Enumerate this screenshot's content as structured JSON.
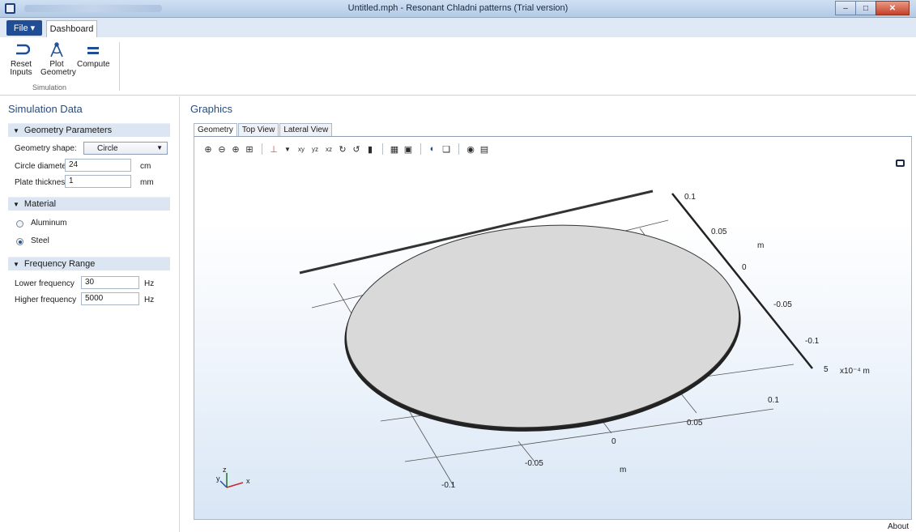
{
  "window": {
    "title": "Untitled.mph - Resonant Chladni patterns (Trial version)"
  },
  "ribbon": {
    "file_label": "File ▾",
    "tab_dashboard": "Dashboard",
    "reset_line1": "Reset",
    "reset_line2": "Inputs",
    "plot_line1": "Plot",
    "plot_line2": "Geometry",
    "compute_label": "Compute",
    "group_label": "Simulation"
  },
  "left": {
    "title": "Simulation Data",
    "geometry_section": "Geometry Parameters",
    "geometry_shape_label": "Geometry shape:",
    "geometry_shape_value": "Circle",
    "circle_diameter_label": "Circle diameter:",
    "circle_diameter_value": "24",
    "circle_diameter_unit": "cm",
    "plate_thickness_label": "Plate thickness:",
    "plate_thickness_value": "1",
    "plate_thickness_unit": "mm",
    "material_section": "Material",
    "material_options": [
      "Aluminum",
      "Steel"
    ],
    "material_selected": "Steel",
    "frequency_section": "Frequency Range",
    "lower_label": "Lower frequency",
    "lower_value": "30",
    "lower_unit": "Hz",
    "higher_label": "Higher frequency",
    "higher_value": "5000",
    "higher_unit": "Hz"
  },
  "graphics": {
    "title": "Graphics",
    "tabs": [
      "Geometry",
      "Top View",
      "Lateral View"
    ],
    "active_tab": "Geometry",
    "axis_right_ticks": [
      "0.1",
      "0.05",
      "0",
      "-0.05",
      "-0.1"
    ],
    "axis_right_unit": "m",
    "axis_z_tick": "5",
    "axis_z_unit": "x10⁻⁴ m",
    "axis_front_ticks": [
      "0.1",
      "0.05",
      "0",
      "-0.05",
      "-0.1"
    ],
    "axis_front_unit": "m",
    "triad": {
      "z": "z",
      "y": "y",
      "x": "x"
    }
  },
  "status": {
    "about": "About"
  }
}
